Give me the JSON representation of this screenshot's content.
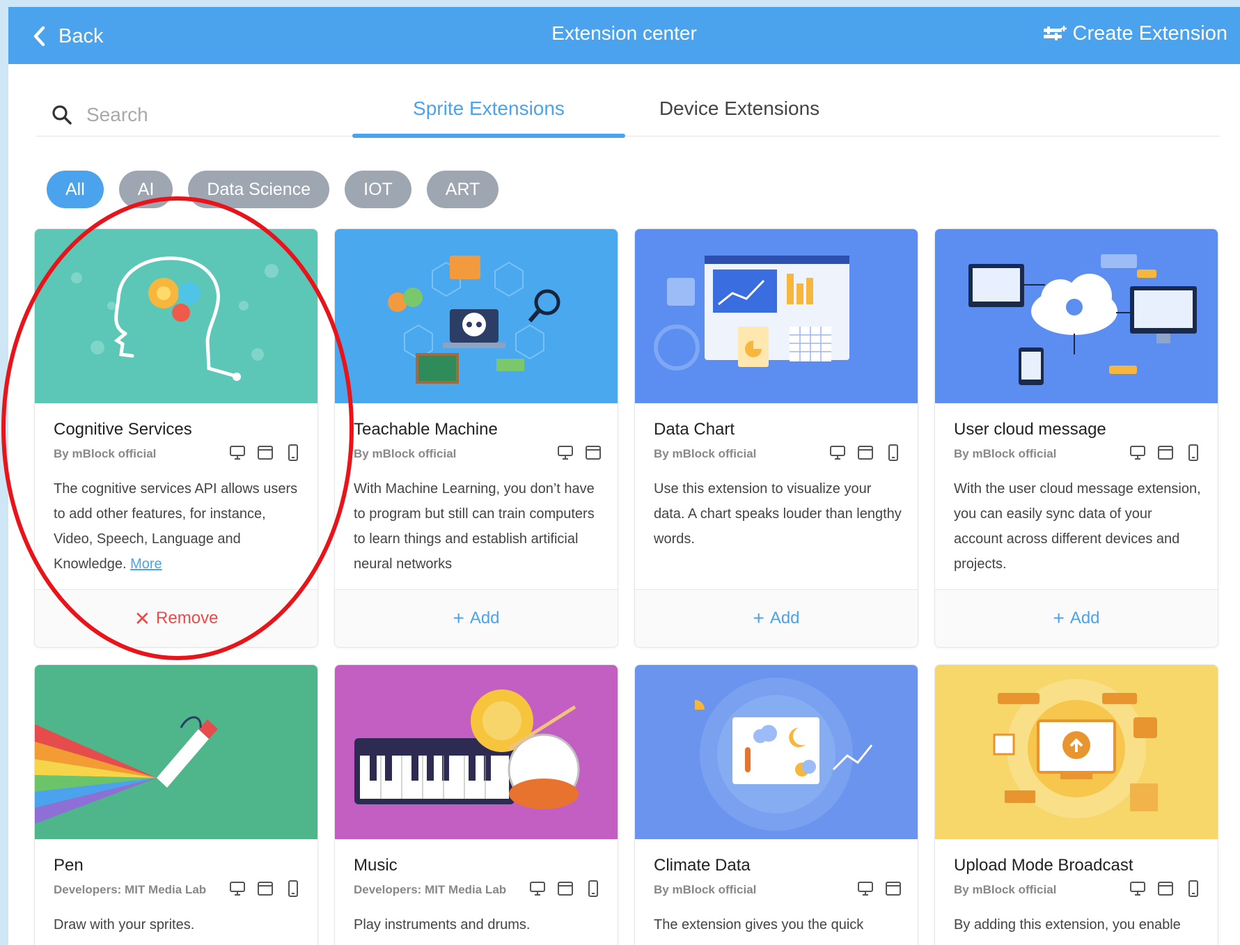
{
  "header": {
    "back_label": "Back",
    "title": "Extension center",
    "create_label": "Create Extension"
  },
  "search": {
    "placeholder": "Search"
  },
  "tabs": [
    {
      "label": "Sprite Extensions",
      "active": true
    },
    {
      "label": "Device Extensions",
      "active": false
    }
  ],
  "filters": [
    {
      "label": "All",
      "active": true
    },
    {
      "label": "AI",
      "active": false
    },
    {
      "label": "Data Science",
      "active": false
    },
    {
      "label": "IOT",
      "active": false
    },
    {
      "label": "ART",
      "active": false
    }
  ],
  "cards": [
    {
      "title": "Cognitive Services",
      "author": "By mBlock official",
      "platforms": [
        "desktop-icon",
        "browser-icon",
        "mobile-icon"
      ],
      "description": "The cognitive services API allows users to add other features, for instance, Video, Speech, Language and Knowledge.",
      "more_label": "More",
      "action_label": "Remove",
      "action_symbol": "✕",
      "thumb_color": "#5cc7b7"
    },
    {
      "title": "Teachable Machine",
      "author": "By mBlock official",
      "platforms": [
        "desktop-icon",
        "browser-icon"
      ],
      "description": "With Machine Learning, you don’t have to program but still can train computers to learn things and establish artificial neural networks",
      "action_label": "Add",
      "action_symbol": "+",
      "thumb_color": "#4aa8ee"
    },
    {
      "title": "Data Chart",
      "author": "By mBlock official",
      "platforms": [
        "desktop-icon",
        "browser-icon",
        "mobile-icon"
      ],
      "description": "Use this extension to visualize your data. A chart speaks louder than lengthy words.",
      "action_label": "Add",
      "action_symbol": "+",
      "thumb_color": "#5b8ef0"
    },
    {
      "title": "User cloud message",
      "author": "By mBlock official",
      "platforms": [
        "desktop-icon",
        "browser-icon",
        "mobile-icon"
      ],
      "description": "With the user cloud message extension, you can easily sync data of your account across different devices and projects.",
      "action_label": "Add",
      "action_symbol": "+",
      "thumb_color": "#5b8ef0"
    },
    {
      "title": "Pen",
      "author": "Developers: MIT Media Lab",
      "platforms": [
        "desktop-icon",
        "browser-icon",
        "mobile-icon"
      ],
      "description": "Draw with your sprites.",
      "thumb_color": "#4fb58b"
    },
    {
      "title": "Music",
      "author": "Developers: MIT Media Lab",
      "platforms": [
        "desktop-icon",
        "browser-icon",
        "mobile-icon"
      ],
      "description": "Play instruments and drums.",
      "thumb_color": "#c35fc2"
    },
    {
      "title": "Climate Data",
      "author": "By mBlock official",
      "platforms": [
        "desktop-icon",
        "browser-icon"
      ],
      "description": "The extension gives you the quick",
      "thumb_color": "#6b94ee"
    },
    {
      "title": "Upload Mode Broadcast",
      "author": "By mBlock official",
      "platforms": [
        "desktop-icon",
        "browser-icon",
        "mobile-icon"
      ],
      "description": "By adding this extension, you enable",
      "thumb_color": "#f7d66a"
    }
  ],
  "colors": {
    "accent": "#4aa3ec",
    "chip_inactive": "#9ea6b2",
    "remove": "#ea4b4b",
    "highlight_circle": "#e8141a"
  }
}
